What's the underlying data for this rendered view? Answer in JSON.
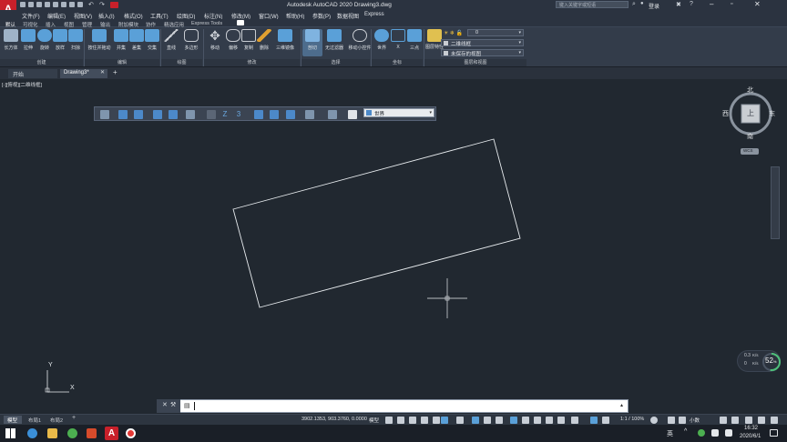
{
  "app": {
    "title": "Autodesk AutoCAD 2020    Drawing3.dwg",
    "search_placeholder": "键入关键字或短语",
    "login": "登录"
  },
  "menu": [
    "文件(F)",
    "编辑(E)",
    "视图(V)",
    "插入(I)",
    "格式(O)",
    "工具(T)",
    "绘图(D)",
    "标注(N)",
    "修改(M)",
    "窗口(W)",
    "帮助(H)",
    "参数(P)",
    "数据视图",
    "Express"
  ],
  "ribbon_tabs": [
    "默认",
    "可视化",
    "插入",
    "视图",
    "管理",
    "输出",
    "附加模块",
    "协作",
    "精选应用",
    "Express Tools"
  ],
  "ribbon_tools": [
    {
      "label": "长方体",
      "color": "#9fb3c8"
    },
    {
      "label": "拉伸",
      "color": "#5aa0d8"
    },
    {
      "label": "旋转",
      "color": "#5aa0d8"
    },
    {
      "label": "放样",
      "color": "#5aa0d8"
    },
    {
      "label": "扫掠",
      "color": "#5aa0d8"
    },
    {
      "label": "按住并拖动",
      "color": "#5aa0d8"
    },
    {
      "label": "并集",
      "color": "#5aa0d8"
    },
    {
      "label": "差集",
      "color": "#5aa0d8"
    },
    {
      "label": "交集",
      "color": "#5aa0d8"
    },
    {
      "label": "直线",
      "color": "#c8ccd2"
    },
    {
      "label": "多边形",
      "color": "#c8ccd2"
    },
    {
      "label": "移动",
      "color": "#c8ccd2"
    },
    {
      "label": "偏移",
      "color": "#c8ccd2"
    },
    {
      "label": "复制",
      "color": "#c8ccd2"
    },
    {
      "label": "删除",
      "color": "#e0a030"
    },
    {
      "label": "三维镜像",
      "color": "#5aa0d8"
    },
    {
      "label": "剖切",
      "color": "#5aa0d8"
    },
    {
      "label": "无过滤器",
      "color": "#5aa0d8"
    },
    {
      "label": "移动小控件",
      "color": "#c8ccd2"
    },
    {
      "label": "世界",
      "color": "#5aa0d8"
    },
    {
      "label": "X",
      "color": "#5aa0d8"
    },
    {
      "label": "三点",
      "color": "#5aa0d8"
    },
    {
      "label": "图层特性",
      "color": "#e0c050"
    }
  ],
  "ribbon_panels": [
    "创建",
    "编辑",
    "绘图",
    "修改",
    "选择",
    "坐标",
    "图层和视图"
  ],
  "layer_combo": "0",
  "view_style": "二维线框",
  "saved_view": "未保存的视图",
  "doc_tabs": [
    "开始",
    "Drawing3*"
  ],
  "viewport_label": "[-][俯视][二维线框]",
  "ucs_combo": "世界",
  "viewcube": {
    "north": "北",
    "south": "南",
    "east": "东",
    "west": "西",
    "face": "上",
    "wcs": "WCS"
  },
  "nav_wheel": {
    "upload": "0.3",
    "download": "0",
    "unit_up": "K/s",
    "unit_down": "K/s",
    "percent": "52"
  },
  "axis": {
    "x": "X",
    "y": "Y"
  },
  "command_prompt": "",
  "layout_tabs": [
    "模型",
    "布局1",
    "布局2"
  ],
  "coords": "3902.1353, 903.3760, 0.0000",
  "status_model": "模型",
  "status_scale": "1:1 / 100%",
  "status_unit": "小数",
  "clock": {
    "time": "16:32",
    "date": "2020/6/1"
  },
  "ime": "英"
}
